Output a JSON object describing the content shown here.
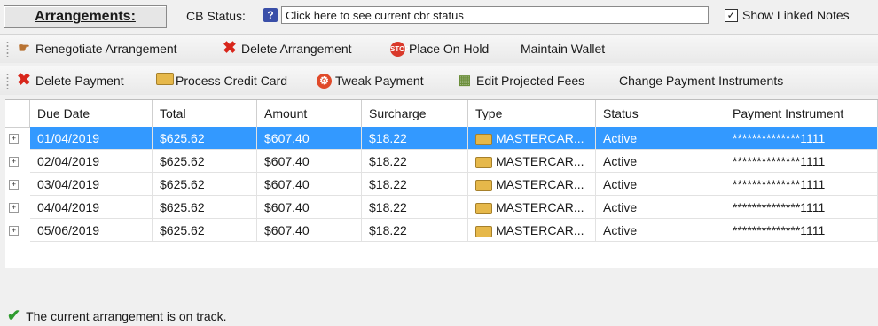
{
  "header": {
    "title": "Arrangements:",
    "cb_status_label": "CB Status:",
    "cb_status_value": "Click here to see current cbr status",
    "show_linked_notes_label": "Show Linked Notes",
    "show_linked_notes_checked": true
  },
  "toolbar1": {
    "renegotiate": "Renegotiate Arrangement",
    "delete_arrangement": "Delete Arrangement",
    "place_on_hold": "Place On Hold",
    "maintain_wallet": "Maintain Wallet"
  },
  "toolbar2": {
    "delete_payment": "Delete Payment",
    "process_credit_card": "Process Credit Card",
    "tweak_payment": "Tweak Payment",
    "edit_projected_fees": "Edit Projected Fees",
    "change_payment_instruments": "Change Payment Instruments"
  },
  "grid": {
    "columns": [
      "Due Date",
      "Total",
      "Amount",
      "Surcharge",
      "Type",
      "Status",
      "Payment Instrument"
    ],
    "rows": [
      {
        "due_date": "01/04/2019",
        "total": "$625.62",
        "amount": "$607.40",
        "surcharge": "$18.22",
        "type": "MASTERCAR...",
        "status": "Active",
        "instrument": "**************1111"
      },
      {
        "due_date": "02/04/2019",
        "total": "$625.62",
        "amount": "$607.40",
        "surcharge": "$18.22",
        "type": "MASTERCAR...",
        "status": "Active",
        "instrument": "**************1111"
      },
      {
        "due_date": "03/04/2019",
        "total": "$625.62",
        "amount": "$607.40",
        "surcharge": "$18.22",
        "type": "MASTERCAR...",
        "status": "Active",
        "instrument": "**************1111"
      },
      {
        "due_date": "04/04/2019",
        "total": "$625.62",
        "amount": "$607.40",
        "surcharge": "$18.22",
        "type": "MASTERCAR...",
        "status": "Active",
        "instrument": "**************1111"
      },
      {
        "due_date": "05/06/2019",
        "total": "$625.62",
        "amount": "$607.40",
        "surcharge": "$18.22",
        "type": "MASTERCAR...",
        "status": "Active",
        "instrument": "**************1111"
      }
    ],
    "selected_row": 0
  },
  "status_bar": {
    "message": "The current arrangement is on track."
  },
  "icons": {
    "renegotiate": "hand-icon",
    "delete": "red-x-icon",
    "hold": "stop-sign-icon",
    "card": "credit-card-icon",
    "tweak": "tweak-icon",
    "fees": "calculator-icon",
    "ok": "green-check-icon"
  },
  "colors": {
    "selection": "#3399ff",
    "delete_red": "#d8261b",
    "ok_green": "#2e9b2e"
  }
}
